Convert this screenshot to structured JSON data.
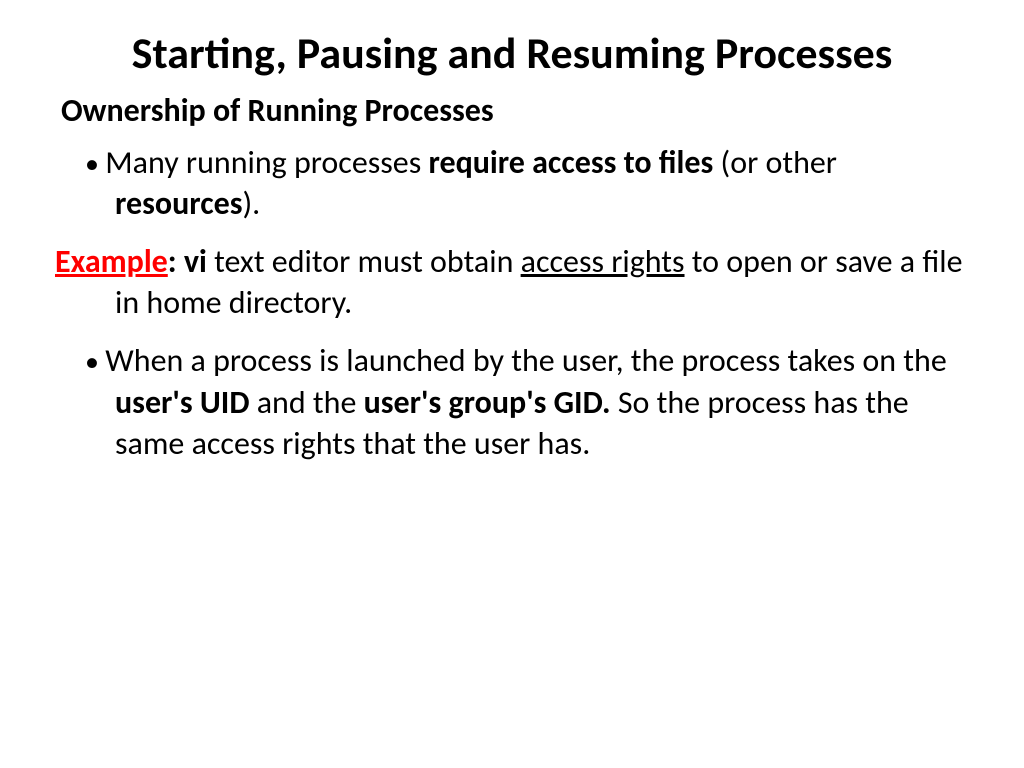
{
  "title": "Starting, Pausing and Resuming Processes",
  "subtitle": "Ownership of Running Processes",
  "item1": {
    "t1": "Many running processes ",
    "t2": "require access to files",
    "t3": " (or other ",
    "t4": "resources",
    "t5": ")."
  },
  "item2": {
    "t1": "Example",
    "t2": ": vi",
    "t3": " text editor must obtain ",
    "t4": "access rights",
    "t5": " to open or save a file in home directory."
  },
  "item3": {
    "t1": " When a process is launched by the user, the process takes on the ",
    "t2": "user's UID",
    "t3": " and the ",
    "t4": "user's group's GID.",
    "t5": " So the process has the same access rights that the user has."
  }
}
